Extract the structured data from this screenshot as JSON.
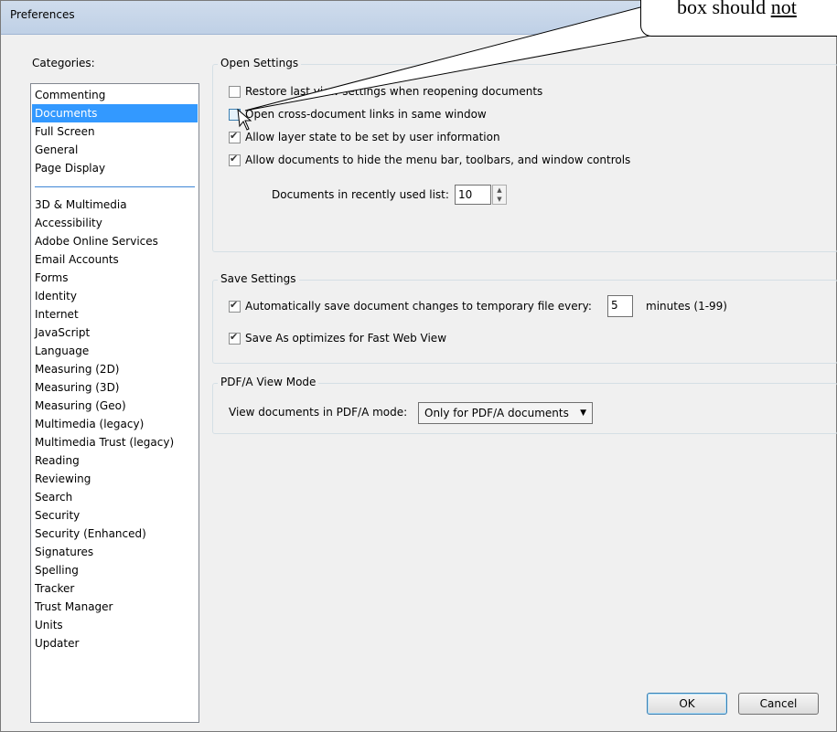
{
  "window": {
    "title": "Preferences"
  },
  "categories": {
    "label": "Categories:",
    "group1": [
      "Commenting",
      "Documents",
      "Full Screen",
      "General",
      "Page Display"
    ],
    "group2": [
      "3D & Multimedia",
      "Accessibility",
      "Adobe Online Services",
      "Email Accounts",
      "Forms",
      "Identity",
      "Internet",
      "JavaScript",
      "Language",
      "Measuring (2D)",
      "Measuring (3D)",
      "Measuring (Geo)",
      "Multimedia (legacy)",
      "Multimedia Trust (legacy)",
      "Reading",
      "Reviewing",
      "Search",
      "Security",
      "Security (Enhanced)",
      "Signatures",
      "Spelling",
      "Tracker",
      "Trust Manager",
      "Units",
      "Updater"
    ],
    "selected": "Documents"
  },
  "open_settings": {
    "title": "Open Settings",
    "restore_label": "Restore last view settings when reopening documents",
    "restore_checked": false,
    "cross_doc_label": "Open cross-document links in same window",
    "cross_doc_checked": false,
    "layer_state_label": "Allow layer state to be set by user information",
    "layer_state_checked": true,
    "hide_menubar_label": "Allow documents to hide the menu bar, toolbars, and window controls",
    "hide_menubar_checked": true,
    "recent_list_label": "Documents in recently used list:",
    "recent_list_value": "10"
  },
  "save_settings": {
    "title": "Save Settings",
    "autosave_label": "Automatically save document changes to temporary file every:",
    "autosave_checked": true,
    "autosave_minutes": "5",
    "minutes_label": "minutes (1-99)",
    "fast_web_label": "Save As optimizes for Fast Web View",
    "fast_web_checked": true
  },
  "pdfa": {
    "title": "PDF/A View Mode",
    "label": "View documents in PDF/A mode:",
    "selected": "Only for PDF/A documents"
  },
  "buttons": {
    "ok": "OK",
    "cancel": "Cancel"
  },
  "callout": {
    "text_before": "box should ",
    "text_underlined": "not"
  },
  "colors": {
    "selection": "#3399ff",
    "window_bg": "#f0f0f0"
  }
}
